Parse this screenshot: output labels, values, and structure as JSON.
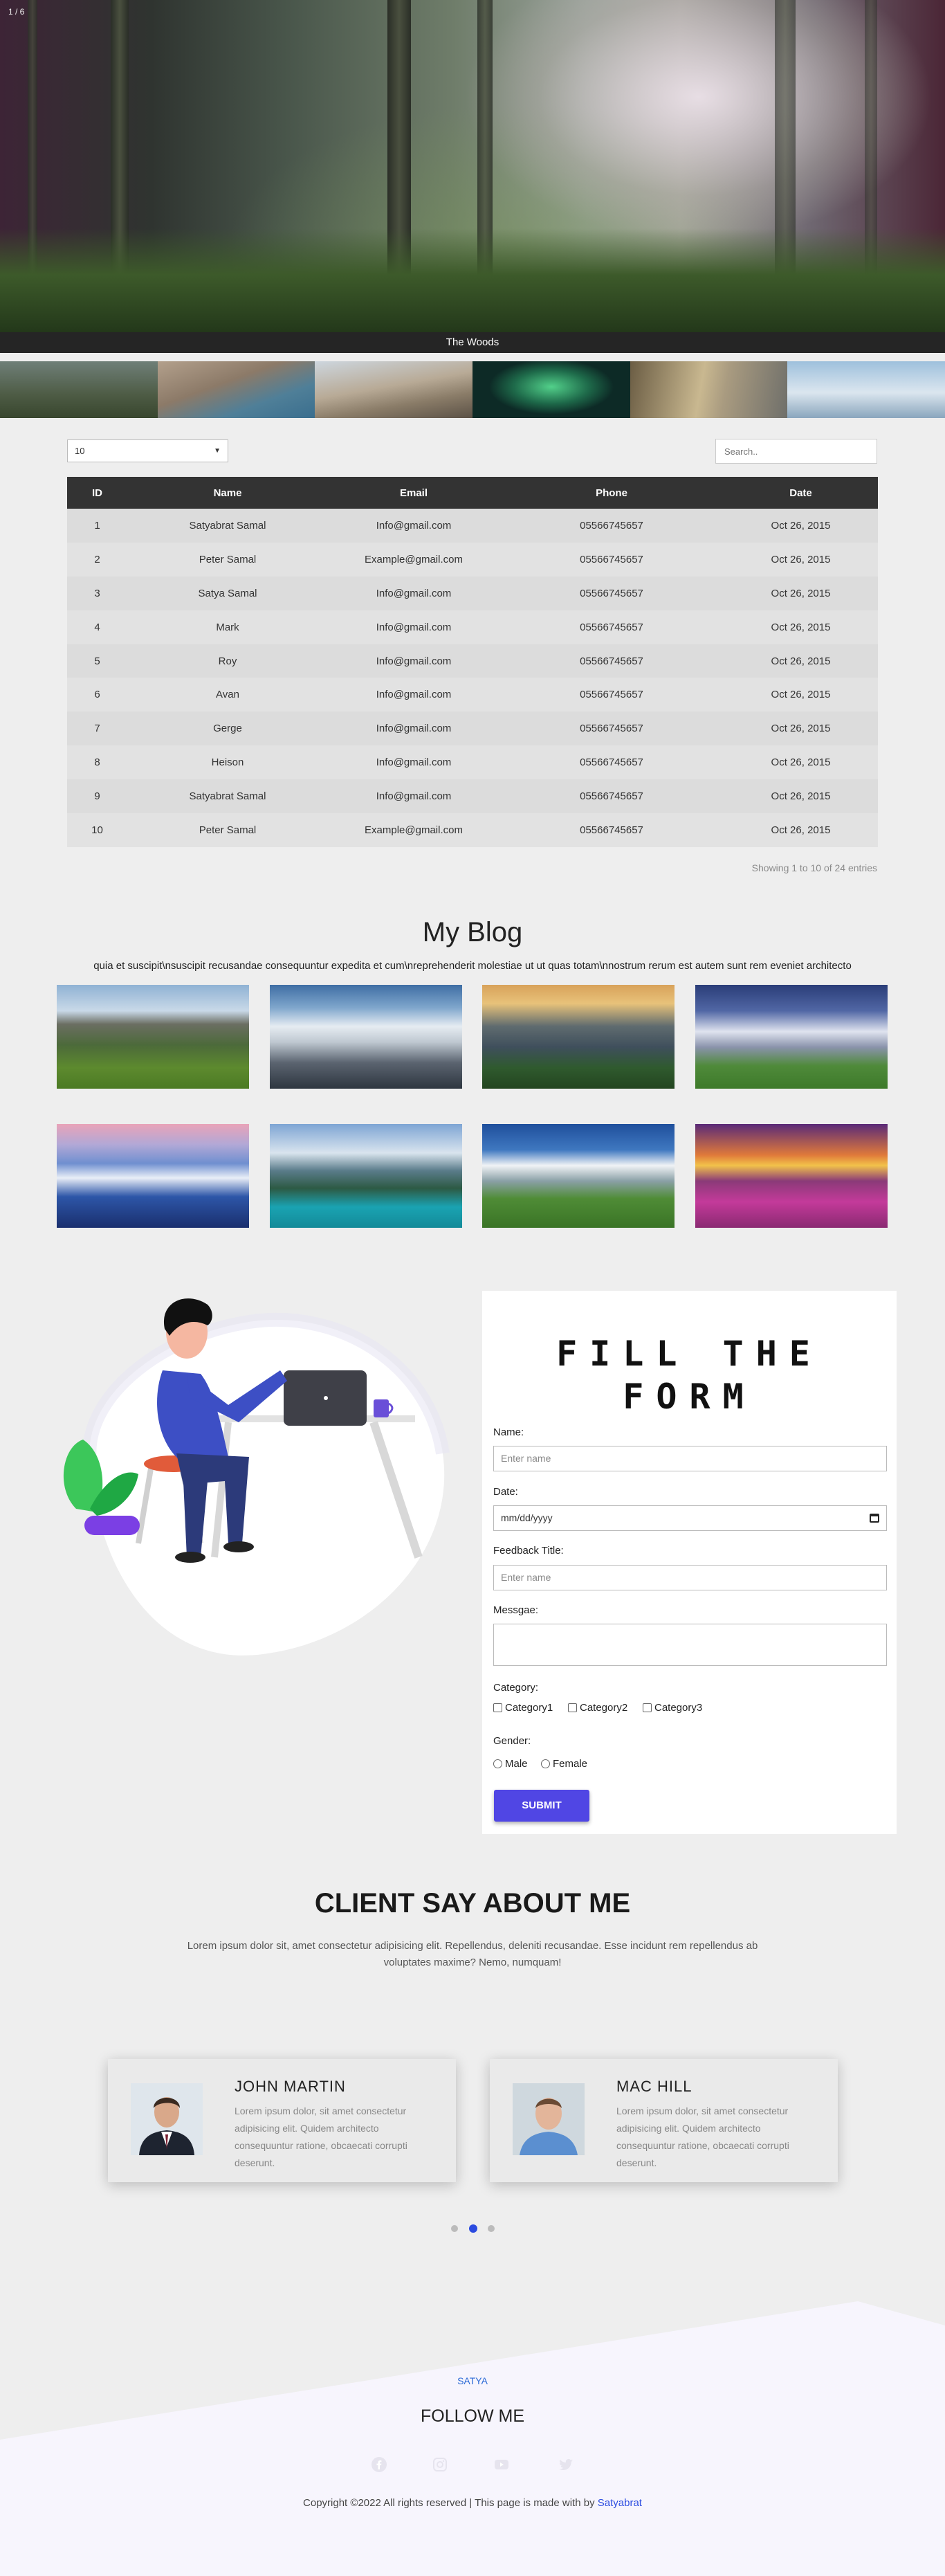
{
  "slideshow": {
    "counter": "1 / 6",
    "caption": "The Woods",
    "thumbnails": [
      "woods-thumb",
      "cliffs-thumb",
      "desert-thumb",
      "aurora-thumb",
      "valley-thumb",
      "mountains-thumb"
    ]
  },
  "table": {
    "entries_value": "10",
    "search_placeholder": "Search..",
    "headers": [
      "ID",
      "Name",
      "Email",
      "Phone",
      "Date"
    ],
    "rows": [
      [
        "1",
        "Satyabrat Samal",
        "Info@gmail.com",
        "05566745657",
        "Oct 26, 2015"
      ],
      [
        "2",
        "Peter Samal",
        "Example@gmail.com",
        "05566745657",
        "Oct 26, 2015"
      ],
      [
        "3",
        "Satya Samal",
        "Info@gmail.com",
        "05566745657",
        "Oct 26, 2015"
      ],
      [
        "4",
        "Mark",
        "Info@gmail.com",
        "05566745657",
        "Oct 26, 2015"
      ],
      [
        "5",
        "Roy",
        "Info@gmail.com",
        "05566745657",
        "Oct 26, 2015"
      ],
      [
        "6",
        "Avan",
        "Info@gmail.com",
        "05566745657",
        "Oct 26, 2015"
      ],
      [
        "7",
        "Gerge",
        "Info@gmail.com",
        "05566745657",
        "Oct 26, 2015"
      ],
      [
        "8",
        "Heison",
        "Info@gmail.com",
        "05566745657",
        "Oct 26, 2015"
      ],
      [
        "9",
        "Satyabrat Samal",
        "Info@gmail.com",
        "05566745657",
        "Oct 26, 2015"
      ],
      [
        "10",
        "Peter Samal",
        "Example@gmail.com",
        "05566745657",
        "Oct 26, 2015"
      ]
    ],
    "info": "Showing 1 to 10 of 24 entries"
  },
  "blog": {
    "title": "My Blog",
    "subtitle": "quia et suscipit\\nsuscipit recusandae consequuntur expedita et cum\\nreprehenderit molestiae ut ut quas totam\\nnostrum rerum est autem sunt rem eveniet architecto"
  },
  "form": {
    "title": "FILL THE FORM",
    "name_label": "Name:",
    "name_placeholder": "Enter name",
    "date_label": "Date:",
    "date_placeholder": "mm/dd/yyyy",
    "feedback_label": "Feedback Title:",
    "feedback_placeholder": "Enter name",
    "message_label": "Messgae:",
    "category_label": "Category:",
    "categories": [
      "Category1",
      "Category2",
      "Category3"
    ],
    "gender_label": "Gender:",
    "genders": [
      "Male",
      "Female"
    ],
    "submit_label": "SUBMIT"
  },
  "clients": {
    "title": "CLIENT SAY ABOUT ME",
    "subtitle": "Lorem ipsum dolor sit, amet consectetur adipisicing elit. Repellendus, deleniti recusandae. Esse incidunt rem repellendus ab voluptates maxime? Nemo, numquam!",
    "cards": [
      {
        "name": "JOHN MARTIN",
        "text": "Lorem ipsum dolor, sit amet consectetur adipisicing elit. Quidem architecto consequuntur ratione, obcaecati corrupti deserunt."
      },
      {
        "name": "MAC HILL",
        "text": "Lorem ipsum dolor, sit amet consectetur adipisicing elit. Quidem architecto consequuntur ratione, obcaecati corrupti deserunt."
      }
    ],
    "active_dot": 2
  },
  "footer": {
    "brand": "SATYA",
    "follow": "FOLLOW ME",
    "social_icons": [
      "facebook-icon",
      "instagram-icon",
      "youtube-icon",
      "twitter-icon"
    ],
    "copyright_prefix": "Copyright ©2022 All rights reserved | This page is made with by ",
    "author": "Satyabrat"
  },
  "colors": {
    "accent": "#5046e4",
    "table_header": "#333333",
    "link": "#2b6ad6"
  }
}
